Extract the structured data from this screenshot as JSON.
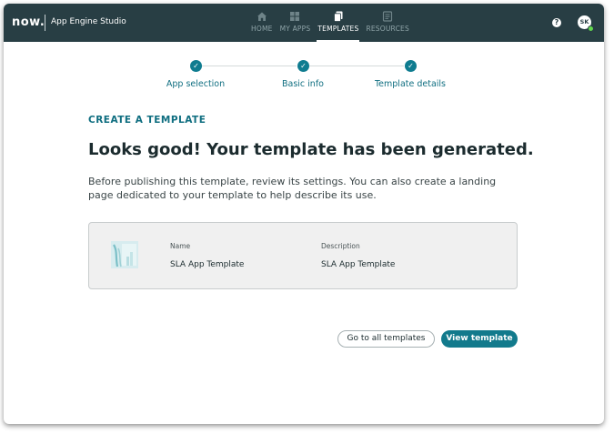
{
  "header": {
    "logo": "now.",
    "app_name": "App Engine Studio",
    "nav": [
      {
        "label": "HOME",
        "icon": "home-icon",
        "active": false
      },
      {
        "label": "MY APPS",
        "icon": "grid-icon",
        "active": false
      },
      {
        "label": "TEMPLATES",
        "icon": "templates-icon",
        "active": true
      },
      {
        "label": "RESOURCES",
        "icon": "resources-icon",
        "active": false
      }
    ],
    "help": "?",
    "avatar_initials": "SK"
  },
  "stepper": {
    "steps": [
      {
        "label": "App selection",
        "status": "complete"
      },
      {
        "label": "Basic info",
        "status": "complete"
      },
      {
        "label": "Template details",
        "status": "complete"
      }
    ],
    "check_glyph": "✓"
  },
  "main": {
    "eyebrow": "CREATE A TEMPLATE",
    "headline": "Looks good! Your template has been generated.",
    "description": "Before publishing this template, review its settings. You can also create a landing page dedicated to your template to help describe its use.",
    "card": {
      "name_label": "Name",
      "name_value": "SLA App Template",
      "description_label": "Description",
      "description_value": "SLA App Template"
    },
    "buttons": {
      "all_templates": "Go to all templates",
      "view_template": "View template"
    }
  },
  "colors": {
    "topbar": "#283e44",
    "accent": "#127a8c",
    "step": "#0f7c90"
  }
}
